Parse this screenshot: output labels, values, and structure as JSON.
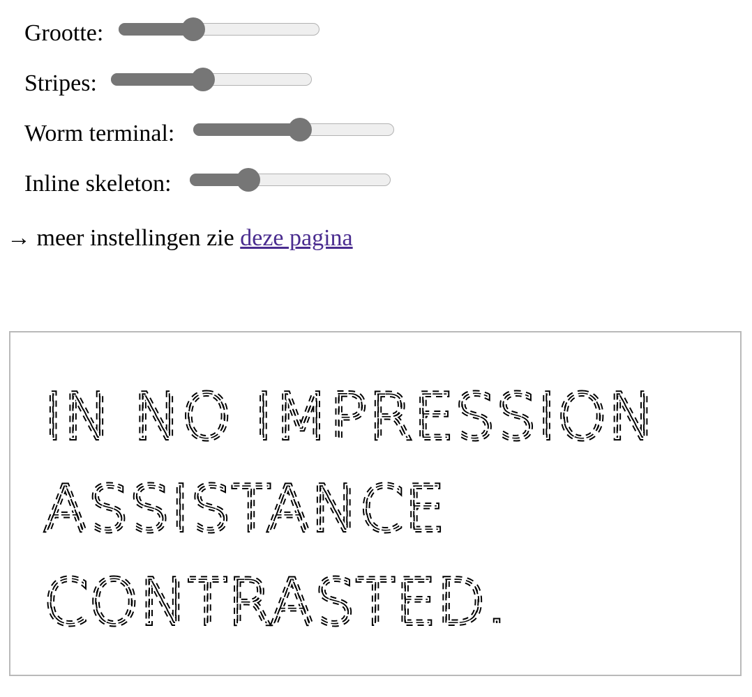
{
  "sliders": [
    {
      "name": "grootte",
      "label": "Grootte:",
      "value": 0.37
    },
    {
      "name": "stripes",
      "label": "Stripes:",
      "value": 0.46
    },
    {
      "name": "worm-terminal",
      "label": "Worm terminal:",
      "value": 0.53
    },
    {
      "name": "inline-skeleton",
      "label": "Inline skeleton:",
      "value": 0.29
    }
  ],
  "more": {
    "arrow": "→",
    "text": " meer instellingen zie ",
    "link": "deze pagina"
  },
  "preview": {
    "lines": [
      "IN NO IMPRESSION",
      "ASSISTANCE",
      "CONTRASTED."
    ]
  }
}
